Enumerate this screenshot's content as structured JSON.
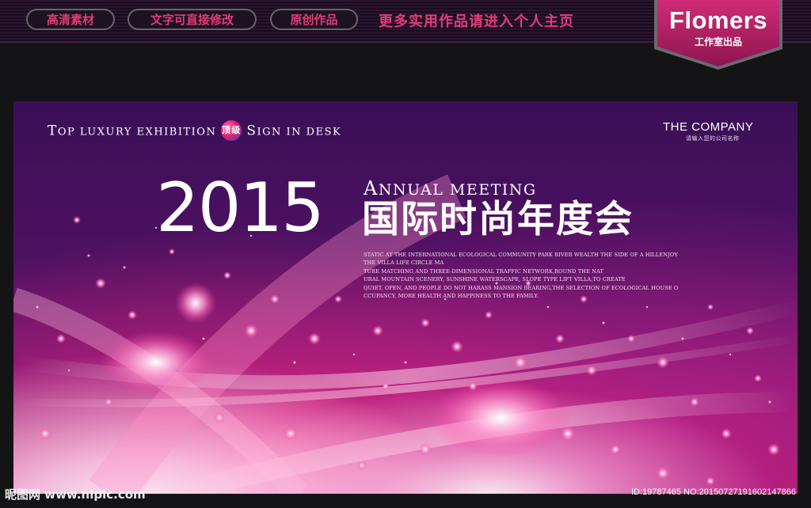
{
  "topbar": {
    "pills": [
      "高清素材",
      "文字可直接修改",
      "原创作品"
    ],
    "promo": "更多实用作品请进入个人主页",
    "badge_name": "Flomers",
    "badge_sub": "工作室出品",
    "badge_color": "#b31f63"
  },
  "poster": {
    "exhibition": {
      "part1_cap": "T",
      "part1_rest": "OP LUXURY EXHIBITION",
      "badge": "顶级",
      "part2_cap": "S",
      "part2_rest": "IGN IN DESK"
    },
    "company_name": "THE COMPANY",
    "company_sub": "请输入您的公司名称",
    "year": "2015",
    "annual_cap": "A",
    "annual_rest": "NNUAL MEETING",
    "title_cn": "国际时尚年度会",
    "description": [
      "STATIC AT THE INTERNATIONAL ECOLOGICAL COMMUNITY PARK RIVER WEALTH THE SIDE OF A HILLENJOY",
      "THE VILLA LIFE CIRCLE MA",
      "TURE MATCHING AND THREE-DIMENSIONAL TRAFFIC NETWORK,ROUND THE NAT",
      "URAL MOUNTAIN SCENERY, SUNSHINE WATERSCAPE, SLOPE TYPE LIFT VILLA,TO CREATE",
      "QUIET, OPEN, AND PEOPLE DO NOT HARASS MANSION BEARING,THE SELECTION OF ECOLOGICAL HOUSE O",
      "CCUPANCY, MORE HEALTH AND HAPPINESS TO THE FAMILY."
    ]
  },
  "watermark": {
    "left": "昵图网 www.nipic.com",
    "right": "ID:19787465 NO:20150727191602147866"
  }
}
